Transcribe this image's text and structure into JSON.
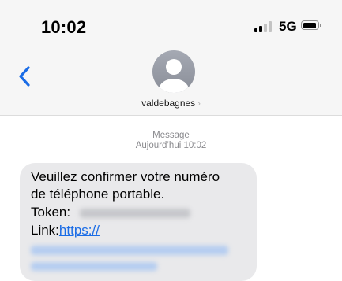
{
  "status_bar": {
    "time": "10:02",
    "network": "5G",
    "signal_icon": "cellular-signal-icon",
    "battery_icon": "battery-icon"
  },
  "nav": {
    "back_icon": "chevron-left-icon",
    "contact_name": "valdebagnes",
    "contact_chevron": "›",
    "avatar_icon": "person-silhouette-icon"
  },
  "conversation": {
    "meta_label": "Message",
    "timestamp": "Aujourd’hui 10:02",
    "message": {
      "line1": "Veuillez confirmer votre numéro",
      "line2": "de téléphone portable.",
      "token_label": "Token:",
      "link_label": "Link:",
      "link_text": "https://"
    }
  },
  "colors": {
    "accent": "#1a6ce6",
    "bubble": "#e9e9eb",
    "header_bg": "#f6f6f6",
    "meta_text": "#8a8a8e"
  }
}
